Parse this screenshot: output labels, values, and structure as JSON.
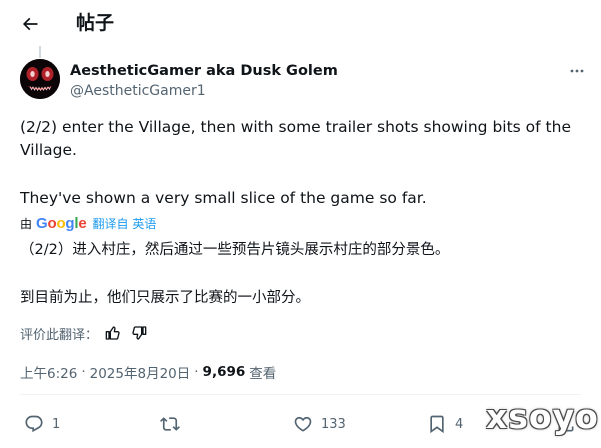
{
  "header": {
    "back_icon": "arrow-left-icon",
    "title": "帖子"
  },
  "author": {
    "name": "AestheticGamer aka Dusk Golem",
    "handle": "@AestheticGamer1",
    "avatar_icon": "red-eyed-face-avatar"
  },
  "post": {
    "line1": "(2/2) enter the Village, then with some trailer shots showing bits of the Village.",
    "line2": "They've shown a very small slice of the game so far."
  },
  "translation": {
    "by_label": "由",
    "provider": "Google",
    "provider_letters": [
      {
        "ch": "G",
        "color": "#4285F4"
      },
      {
        "ch": "o",
        "color": "#EA4335"
      },
      {
        "ch": "o",
        "color": "#FBBC05"
      },
      {
        "ch": "g",
        "color": "#4285F4"
      },
      {
        "ch": "l",
        "color": "#34A853"
      },
      {
        "ch": "e",
        "color": "#EA4335"
      }
    ],
    "link_text": "翻译自 英语",
    "text1": "（2/2）进入村庄，然后通过一些预告片镜头展示村庄的部分景色。",
    "text2": "到目前为止，他们只展示了比赛的一小部分。",
    "rate_label": "评价此翻译："
  },
  "meta": {
    "time": "上午6:26",
    "separator": "·",
    "date": "2025年8月20日",
    "separator2": "·",
    "views": "9,696",
    "views_label": "查看"
  },
  "actions": {
    "replies": "1",
    "retweets": "",
    "likes": "133",
    "bookmarks": "4"
  },
  "watermark": "xsoyo",
  "colors": {
    "accent": "#1d9bf0",
    "text": "#0f1419",
    "muted": "#536471"
  }
}
